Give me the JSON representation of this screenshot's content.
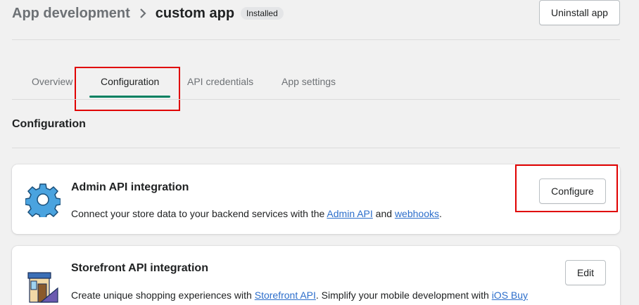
{
  "header": {
    "breadcrumb_parent": "App development",
    "title": "custom app",
    "status_badge": "Installed",
    "uninstall_label": "Uninstall app"
  },
  "tabs": [
    {
      "label": "Overview"
    },
    {
      "label": "Configuration"
    },
    {
      "label": "API credentials"
    },
    {
      "label": "App settings"
    }
  ],
  "section_title": "Configuration",
  "cards": {
    "admin": {
      "title": "Admin API integration",
      "desc_prefix": "Connect your store data to your backend services with the ",
      "link1": "Admin API",
      "desc_mid": " and ",
      "link2": "webhooks",
      "desc_suffix": ".",
      "button_label": "Configure",
      "icon": "gear-icon"
    },
    "storefront": {
      "title": "Storefront API integration",
      "desc_prefix": "Create unique shopping experiences with ",
      "link1": "Storefront API",
      "desc_mid": ". Simplify your mobile development with ",
      "link2": "iOS Buy",
      "button_label": "Edit",
      "icon": "storefront-icon"
    }
  },
  "colors": {
    "accent": "#008060",
    "highlight": "#e00000",
    "link": "#2c6ecb",
    "gear": "#4aa3df"
  }
}
